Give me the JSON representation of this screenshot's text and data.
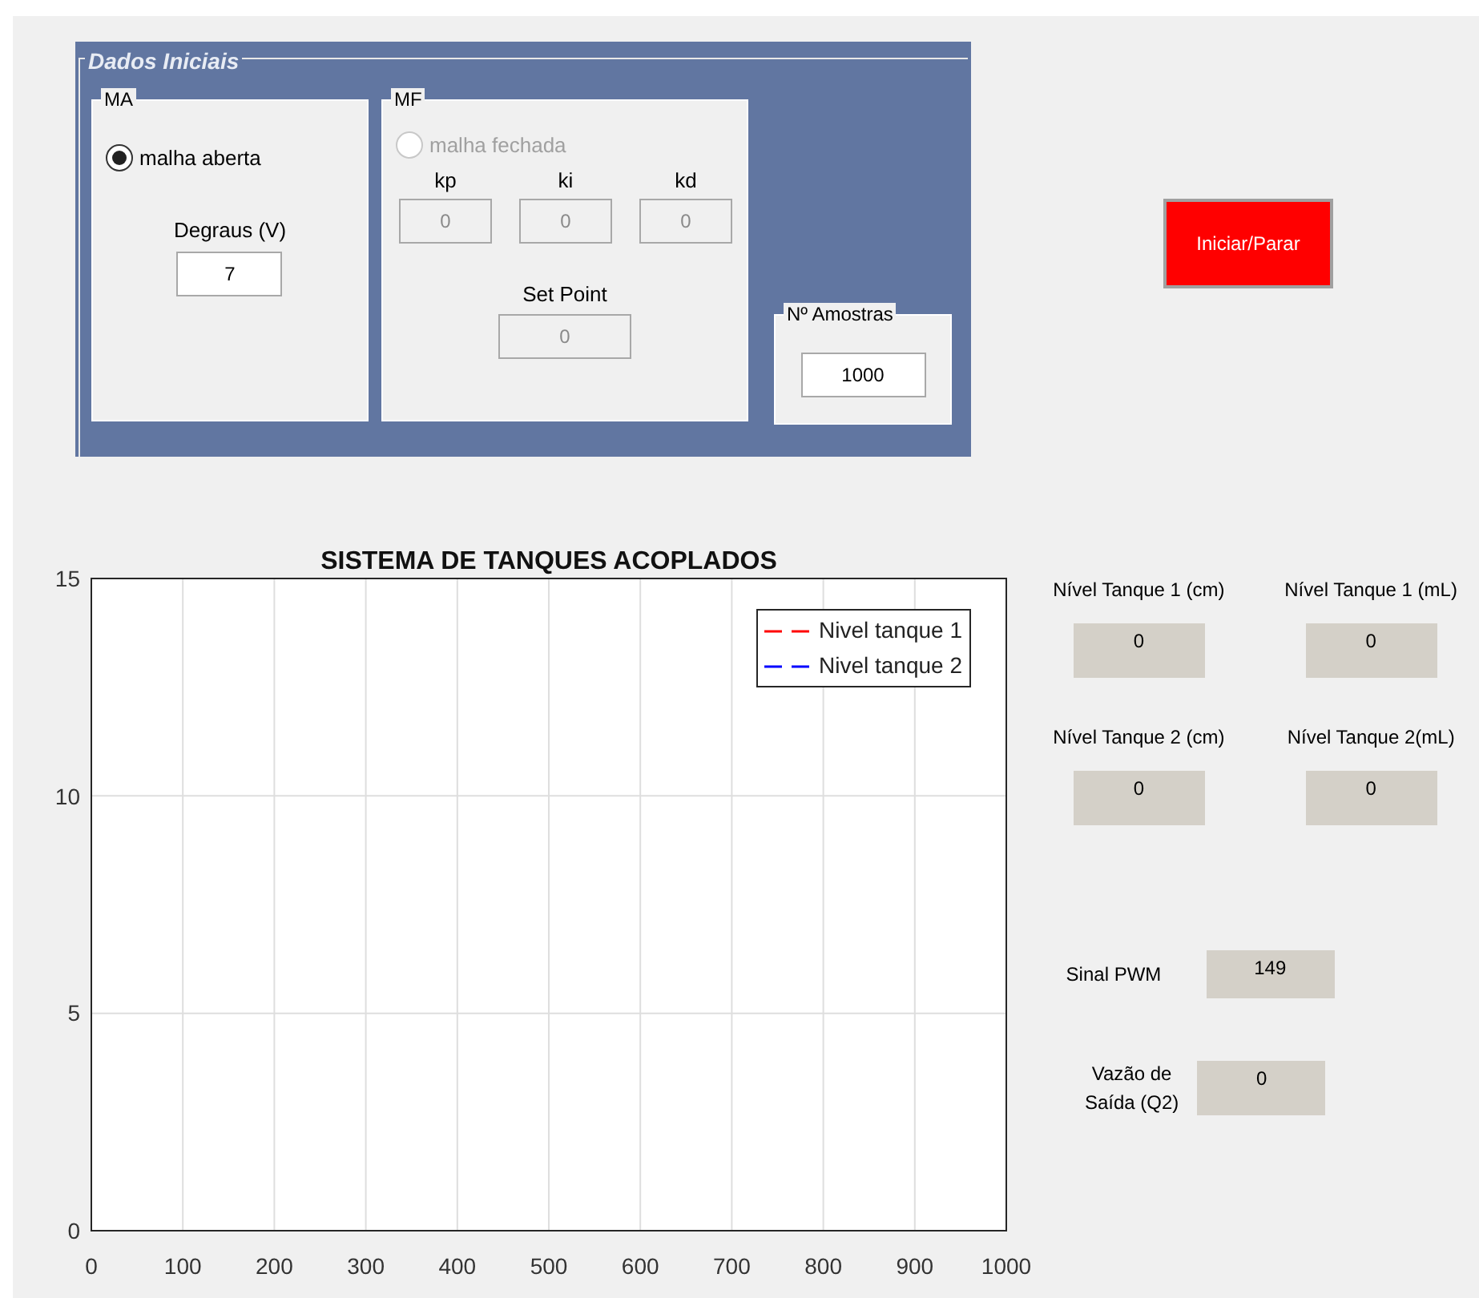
{
  "initial_data": {
    "title": "Dados Iniciais",
    "open_loop": {
      "title": "MA",
      "radio": {
        "label": "malha aberta",
        "selected": true,
        "disabled": false
      },
      "steps": {
        "label": "Degraus (V)",
        "value": "7"
      }
    },
    "closed_loop": {
      "title": "MF",
      "radio": {
        "label": "malha fechada",
        "selected": false,
        "disabled": true
      },
      "gains": [
        {
          "label": "kp",
          "value": "0"
        },
        {
          "label": "ki",
          "value": "0"
        },
        {
          "label": "kd",
          "value": "0"
        }
      ],
      "set_point": {
        "label": "Set Point",
        "value": "0"
      }
    },
    "samples": {
      "title": "Nº Amostras",
      "value": "1000"
    }
  },
  "start_button": {
    "label": "Iniciar/Parar"
  },
  "plot": {
    "chart_data": {
      "type": "line",
      "title": "SISTEMA DE TANQUES ACOPLADOS",
      "grid": true,
      "ylim": [
        0,
        15
      ],
      "categories": [
        "0",
        "100",
        "200",
        "300",
        "400",
        "500",
        "600",
        "700",
        "800",
        "900",
        "1000"
      ],
      "yticks": [
        0,
        5,
        10,
        15
      ],
      "series": [
        {
          "name": "Nivel tanque 1",
          "color": "#ff0000",
          "values": [
            null,
            null,
            null,
            null,
            null,
            null,
            null,
            null,
            null,
            null,
            null
          ]
        },
        {
          "name": "Nivel tanque 2",
          "color": "#0000ff",
          "values": [
            null,
            null,
            null,
            null,
            null,
            null,
            null,
            null,
            null,
            null,
            null
          ]
        }
      ]
    }
  },
  "readouts": [
    {
      "label": "Nível Tanque 1 (cm)",
      "value": "0"
    },
    {
      "label": "Nível Tanque 1 (mL)",
      "value": "0"
    },
    {
      "label": "Nível Tanque 2 (cm)",
      "value": "0"
    },
    {
      "label": "Nível Tanque 2(mL)",
      "value": "0"
    }
  ],
  "pwm": {
    "label": "Sinal PWM",
    "value": "149"
  },
  "outflow": {
    "label": "Vazão de Saída (Q2)",
    "value": "0"
  }
}
